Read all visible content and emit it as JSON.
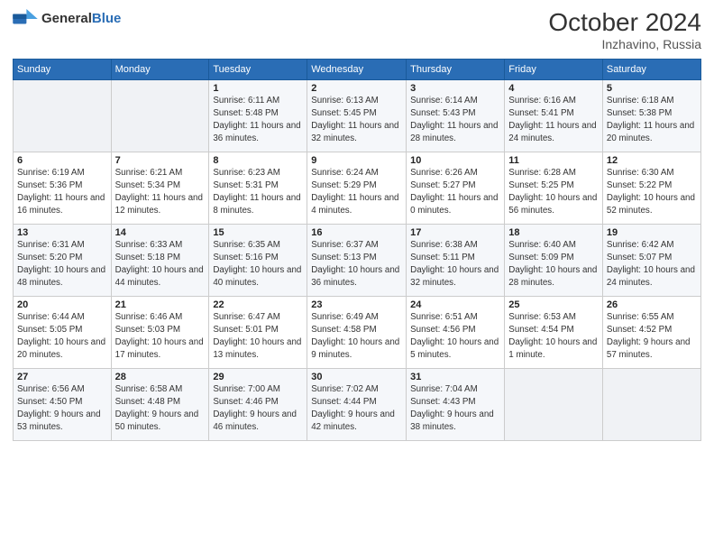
{
  "header": {
    "logo_general": "General",
    "logo_blue": "Blue",
    "month": "October 2024",
    "location": "Inzhavino, Russia"
  },
  "weekdays": [
    "Sunday",
    "Monday",
    "Tuesday",
    "Wednesday",
    "Thursday",
    "Friday",
    "Saturday"
  ],
  "weeks": [
    [
      {
        "day": "",
        "sunrise": "",
        "sunset": "",
        "daylight": ""
      },
      {
        "day": "",
        "sunrise": "",
        "sunset": "",
        "daylight": ""
      },
      {
        "day": "1",
        "sunrise": "Sunrise: 6:11 AM",
        "sunset": "Sunset: 5:48 PM",
        "daylight": "Daylight: 11 hours and 36 minutes."
      },
      {
        "day": "2",
        "sunrise": "Sunrise: 6:13 AM",
        "sunset": "Sunset: 5:45 PM",
        "daylight": "Daylight: 11 hours and 32 minutes."
      },
      {
        "day": "3",
        "sunrise": "Sunrise: 6:14 AM",
        "sunset": "Sunset: 5:43 PM",
        "daylight": "Daylight: 11 hours and 28 minutes."
      },
      {
        "day": "4",
        "sunrise": "Sunrise: 6:16 AM",
        "sunset": "Sunset: 5:41 PM",
        "daylight": "Daylight: 11 hours and 24 minutes."
      },
      {
        "day": "5",
        "sunrise": "Sunrise: 6:18 AM",
        "sunset": "Sunset: 5:38 PM",
        "daylight": "Daylight: 11 hours and 20 minutes."
      }
    ],
    [
      {
        "day": "6",
        "sunrise": "Sunrise: 6:19 AM",
        "sunset": "Sunset: 5:36 PM",
        "daylight": "Daylight: 11 hours and 16 minutes."
      },
      {
        "day": "7",
        "sunrise": "Sunrise: 6:21 AM",
        "sunset": "Sunset: 5:34 PM",
        "daylight": "Daylight: 11 hours and 12 minutes."
      },
      {
        "day": "8",
        "sunrise": "Sunrise: 6:23 AM",
        "sunset": "Sunset: 5:31 PM",
        "daylight": "Daylight: 11 hours and 8 minutes."
      },
      {
        "day": "9",
        "sunrise": "Sunrise: 6:24 AM",
        "sunset": "Sunset: 5:29 PM",
        "daylight": "Daylight: 11 hours and 4 minutes."
      },
      {
        "day": "10",
        "sunrise": "Sunrise: 6:26 AM",
        "sunset": "Sunset: 5:27 PM",
        "daylight": "Daylight: 11 hours and 0 minutes."
      },
      {
        "day": "11",
        "sunrise": "Sunrise: 6:28 AM",
        "sunset": "Sunset: 5:25 PM",
        "daylight": "Daylight: 10 hours and 56 minutes."
      },
      {
        "day": "12",
        "sunrise": "Sunrise: 6:30 AM",
        "sunset": "Sunset: 5:22 PM",
        "daylight": "Daylight: 10 hours and 52 minutes."
      }
    ],
    [
      {
        "day": "13",
        "sunrise": "Sunrise: 6:31 AM",
        "sunset": "Sunset: 5:20 PM",
        "daylight": "Daylight: 10 hours and 48 minutes."
      },
      {
        "day": "14",
        "sunrise": "Sunrise: 6:33 AM",
        "sunset": "Sunset: 5:18 PM",
        "daylight": "Daylight: 10 hours and 44 minutes."
      },
      {
        "day": "15",
        "sunrise": "Sunrise: 6:35 AM",
        "sunset": "Sunset: 5:16 PM",
        "daylight": "Daylight: 10 hours and 40 minutes."
      },
      {
        "day": "16",
        "sunrise": "Sunrise: 6:37 AM",
        "sunset": "Sunset: 5:13 PM",
        "daylight": "Daylight: 10 hours and 36 minutes."
      },
      {
        "day": "17",
        "sunrise": "Sunrise: 6:38 AM",
        "sunset": "Sunset: 5:11 PM",
        "daylight": "Daylight: 10 hours and 32 minutes."
      },
      {
        "day": "18",
        "sunrise": "Sunrise: 6:40 AM",
        "sunset": "Sunset: 5:09 PM",
        "daylight": "Daylight: 10 hours and 28 minutes."
      },
      {
        "day": "19",
        "sunrise": "Sunrise: 6:42 AM",
        "sunset": "Sunset: 5:07 PM",
        "daylight": "Daylight: 10 hours and 24 minutes."
      }
    ],
    [
      {
        "day": "20",
        "sunrise": "Sunrise: 6:44 AM",
        "sunset": "Sunset: 5:05 PM",
        "daylight": "Daylight: 10 hours and 20 minutes."
      },
      {
        "day": "21",
        "sunrise": "Sunrise: 6:46 AM",
        "sunset": "Sunset: 5:03 PM",
        "daylight": "Daylight: 10 hours and 17 minutes."
      },
      {
        "day": "22",
        "sunrise": "Sunrise: 6:47 AM",
        "sunset": "Sunset: 5:01 PM",
        "daylight": "Daylight: 10 hours and 13 minutes."
      },
      {
        "day": "23",
        "sunrise": "Sunrise: 6:49 AM",
        "sunset": "Sunset: 4:58 PM",
        "daylight": "Daylight: 10 hours and 9 minutes."
      },
      {
        "day": "24",
        "sunrise": "Sunrise: 6:51 AM",
        "sunset": "Sunset: 4:56 PM",
        "daylight": "Daylight: 10 hours and 5 minutes."
      },
      {
        "day": "25",
        "sunrise": "Sunrise: 6:53 AM",
        "sunset": "Sunset: 4:54 PM",
        "daylight": "Daylight: 10 hours and 1 minute."
      },
      {
        "day": "26",
        "sunrise": "Sunrise: 6:55 AM",
        "sunset": "Sunset: 4:52 PM",
        "daylight": "Daylight: 9 hours and 57 minutes."
      }
    ],
    [
      {
        "day": "27",
        "sunrise": "Sunrise: 6:56 AM",
        "sunset": "Sunset: 4:50 PM",
        "daylight": "Daylight: 9 hours and 53 minutes."
      },
      {
        "day": "28",
        "sunrise": "Sunrise: 6:58 AM",
        "sunset": "Sunset: 4:48 PM",
        "daylight": "Daylight: 9 hours and 50 minutes."
      },
      {
        "day": "29",
        "sunrise": "Sunrise: 7:00 AM",
        "sunset": "Sunset: 4:46 PM",
        "daylight": "Daylight: 9 hours and 46 minutes."
      },
      {
        "day": "30",
        "sunrise": "Sunrise: 7:02 AM",
        "sunset": "Sunset: 4:44 PM",
        "daylight": "Daylight: 9 hours and 42 minutes."
      },
      {
        "day": "31",
        "sunrise": "Sunrise: 7:04 AM",
        "sunset": "Sunset: 4:43 PM",
        "daylight": "Daylight: 9 hours and 38 minutes."
      },
      {
        "day": "",
        "sunrise": "",
        "sunset": "",
        "daylight": ""
      },
      {
        "day": "",
        "sunrise": "",
        "sunset": "",
        "daylight": ""
      }
    ]
  ]
}
